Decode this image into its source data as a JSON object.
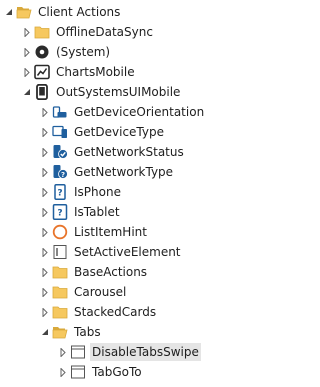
{
  "tree": {
    "root": {
      "label": "Client Actions",
      "icon": "folder-open-icon"
    },
    "items": [
      {
        "label": "OfflineDataSync",
        "icon": "folder-icon"
      },
      {
        "label": "(System)",
        "icon": "system-module-icon"
      },
      {
        "label": "ChartsMobile",
        "icon": "chart-module-icon"
      },
      {
        "label": "OutSystemsUIMobile",
        "icon": "mobile-module-icon"
      },
      {
        "label": "GetDeviceOrientation",
        "icon": "device-orientation-icon"
      },
      {
        "label": "GetDeviceType",
        "icon": "device-type-icon"
      },
      {
        "label": "GetNetworkStatus",
        "icon": "network-status-icon"
      },
      {
        "label": "GetNetworkType",
        "icon": "network-type-icon"
      },
      {
        "label": "IsPhone",
        "icon": "phone-question-icon"
      },
      {
        "label": "IsTablet",
        "icon": "tablet-question-icon"
      },
      {
        "label": "ListItemHint",
        "icon": "hint-circle-icon"
      },
      {
        "label": "SetActiveElement",
        "icon": "active-element-icon"
      },
      {
        "label": "BaseActions",
        "icon": "folder-icon"
      },
      {
        "label": "Carousel",
        "icon": "folder-icon"
      },
      {
        "label": "StackedCards",
        "icon": "folder-icon"
      },
      {
        "label": "Tabs",
        "icon": "folder-open-icon"
      },
      {
        "label": "DisableTabsSwipe",
        "icon": "action-icon",
        "selected": true
      },
      {
        "label": "TabGoTo",
        "icon": "action-icon"
      }
    ]
  }
}
